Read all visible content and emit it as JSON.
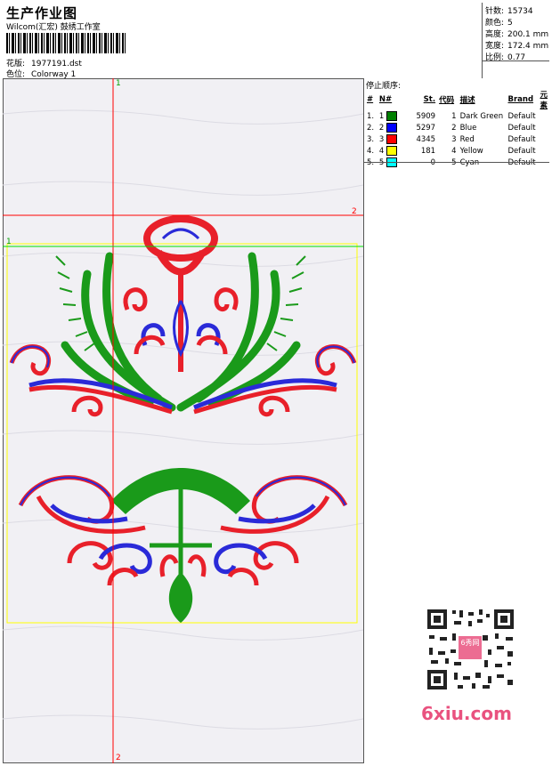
{
  "header": {
    "title": "生产作业图",
    "subtitle": "Wilcom(汇宏) 鼓绣工作室",
    "design_label": "花版:",
    "design_value": "1977191.dst",
    "colorway_label": "色位:",
    "colorway_value": "Colorway 1"
  },
  "stats": [
    {
      "label": "针数:",
      "value": "15734"
    },
    {
      "label": "颜色:",
      "value": "5"
    },
    {
      "label": "高度:",
      "value": "200.1 mm"
    },
    {
      "label": "宽度:",
      "value": "172.4 mm"
    },
    {
      "label": "比例:",
      "value": "0.77"
    }
  ],
  "stop_sequence": {
    "title": "停止顺序:",
    "headers": [
      "#",
      "N#",
      "St.",
      "代码",
      "描述",
      "Brand",
      "元素"
    ],
    "rows": [
      {
        "num": "1.",
        "n": "1",
        "color": "#008000",
        "stitches": "5909",
        "code": "1",
        "desc": "Dark Green",
        "brand": "Default"
      },
      {
        "num": "2.",
        "n": "2",
        "color": "#0000ff",
        "stitches": "5297",
        "code": "2",
        "desc": "Blue",
        "brand": "Default"
      },
      {
        "num": "3.",
        "n": "3",
        "color": "#ff0000",
        "stitches": "4345",
        "code": "3",
        "desc": "Red",
        "brand": "Default"
      },
      {
        "num": "4.",
        "n": "4",
        "color": "#ffff00",
        "stitches": "181",
        "code": "4",
        "desc": "Yellow",
        "brand": "Default"
      },
      {
        "num": "5.",
        "n": "5",
        "color": "#00ffff",
        "stitches": "0",
        "code": "5",
        "desc": "Cyan",
        "brand": "Default"
      }
    ]
  },
  "axis_labels": {
    "top_v": "1",
    "bottom_v": "2",
    "right_h": "2",
    "left_h": "1"
  },
  "watermark": "6xiu.com",
  "qr_stamp": "6秀网"
}
